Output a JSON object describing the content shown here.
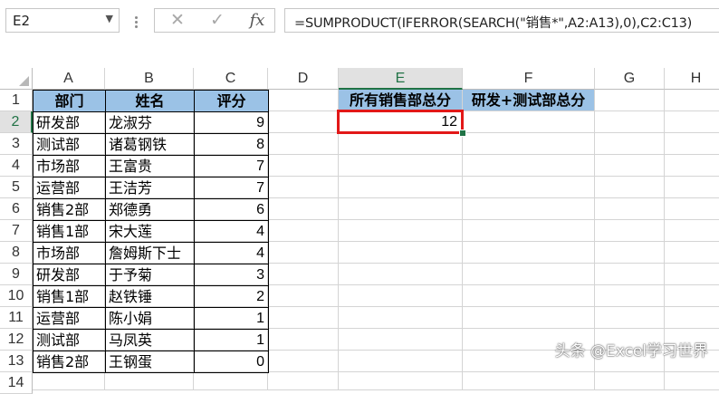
{
  "name_box": {
    "value": "E2"
  },
  "formula_bar": {
    "cancel_icon": "✕",
    "enter_icon": "✓",
    "fx_label": "fx",
    "formula": "=SUMPRODUCT(IFERROR(SEARCH(\"销售*\",A2:A13),0),C2:C13)"
  },
  "columns": [
    "A",
    "B",
    "C",
    "D",
    "E",
    "F",
    "G",
    "H"
  ],
  "selected_column": "E",
  "rows": [
    "1",
    "2",
    "3",
    "4",
    "5",
    "6",
    "7",
    "8",
    "9",
    "10",
    "11",
    "12",
    "13",
    "14"
  ],
  "selected_row": "2",
  "table": {
    "headers": [
      "部门",
      "姓名",
      "评分"
    ],
    "data": [
      [
        "研发部",
        "龙淑芬",
        "9"
      ],
      [
        "测试部",
        "诸葛钢铁",
        "8"
      ],
      [
        "市场部",
        "王富贵",
        "7"
      ],
      [
        "运营部",
        "王洁芳",
        "7"
      ],
      [
        "销售2部",
        "郑德勇",
        "6"
      ],
      [
        "销售1部",
        "宋大莲",
        "4"
      ],
      [
        "市场部",
        "詹姆斯下士",
        "4"
      ],
      [
        "研发部",
        "于予菊",
        "3"
      ],
      [
        "销售1部",
        "赵铁锤",
        "2"
      ],
      [
        "运营部",
        "陈小娟",
        "1"
      ],
      [
        "测试部",
        "马凤英",
        "1"
      ],
      [
        "销售2部",
        "王钢蛋",
        "0"
      ]
    ]
  },
  "summary": {
    "e1_header": "所有销售部总分",
    "f1_header": "研发+测试部总分",
    "e2_value": "12"
  },
  "watermark": "头条 @Excel学习世界",
  "colors": {
    "header_fill": "#9bc2e6",
    "active_border": "#e21818",
    "excel_green": "#217346"
  }
}
